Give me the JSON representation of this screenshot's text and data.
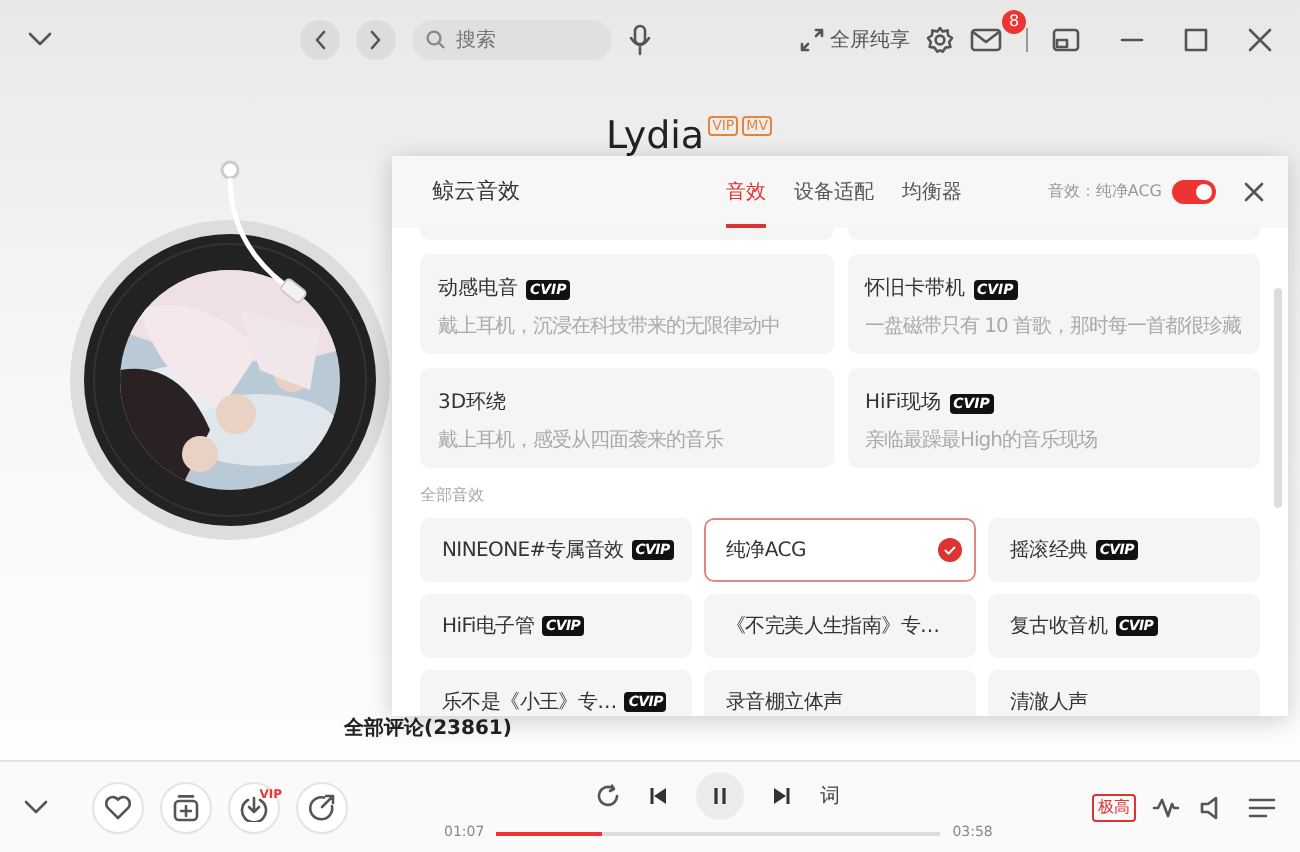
{
  "top_bar": {
    "search": {
      "placeholder": "搜索"
    },
    "fullscreen_label": "全屏纯享",
    "mail_badge": "8"
  },
  "song": {
    "title": "Lydia",
    "tags": [
      "VIP",
      "MV"
    ]
  },
  "comments": {
    "label": "全部评论(23861)"
  },
  "effects_panel": {
    "title": "鲸云音效",
    "tabs": [
      {
        "label": "音效",
        "selected": true
      },
      {
        "label": "设备适配",
        "selected": false
      },
      {
        "label": "均衡器",
        "selected": false
      }
    ],
    "current_label": "音效：纯净ACG",
    "switch_on": true,
    "featured": [
      {
        "name": "动感电音",
        "badge": "CVIP",
        "desc": "戴上耳机，沉浸在科技带来的无限律动中"
      },
      {
        "name": "怀旧卡带机",
        "badge": "CVIP",
        "desc": "一盘磁带只有 10 首歌，那时每一首都很珍藏"
      },
      {
        "name": "3D环绕",
        "desc": "戴上耳机，感受从四面袭来的音乐"
      },
      {
        "name": "HiFi现场",
        "badge": "CVIP",
        "desc": "亲临最躁最High的音乐现场"
      }
    ],
    "section_label": "全部音效",
    "effects": [
      {
        "name": "NINEONE#专属音效",
        "badge": "CVIP",
        "selected": false
      },
      {
        "name": "纯净ACG",
        "selected": true
      },
      {
        "name": "摇滚经典",
        "badge": "CVIP",
        "selected": false
      },
      {
        "name": "HiFi电子管",
        "badge": "CVIP",
        "selected": false
      },
      {
        "name": "《不完美人生指南》专…",
        "selected": false
      },
      {
        "name": "复古收音机",
        "badge": "CVIP",
        "selected": false
      },
      {
        "name": "乐不是《小王》专…",
        "badge": "CVIP",
        "selected": false
      },
      {
        "name": "录音棚立体声",
        "selected": false
      },
      {
        "name": "清澈人声",
        "selected": false
      }
    ]
  },
  "player": {
    "download_badge": "VIP",
    "lyrics_button": "词",
    "elapsed": "01:07",
    "duration": "03:58",
    "level": 0.24,
    "quality": "极高"
  }
}
